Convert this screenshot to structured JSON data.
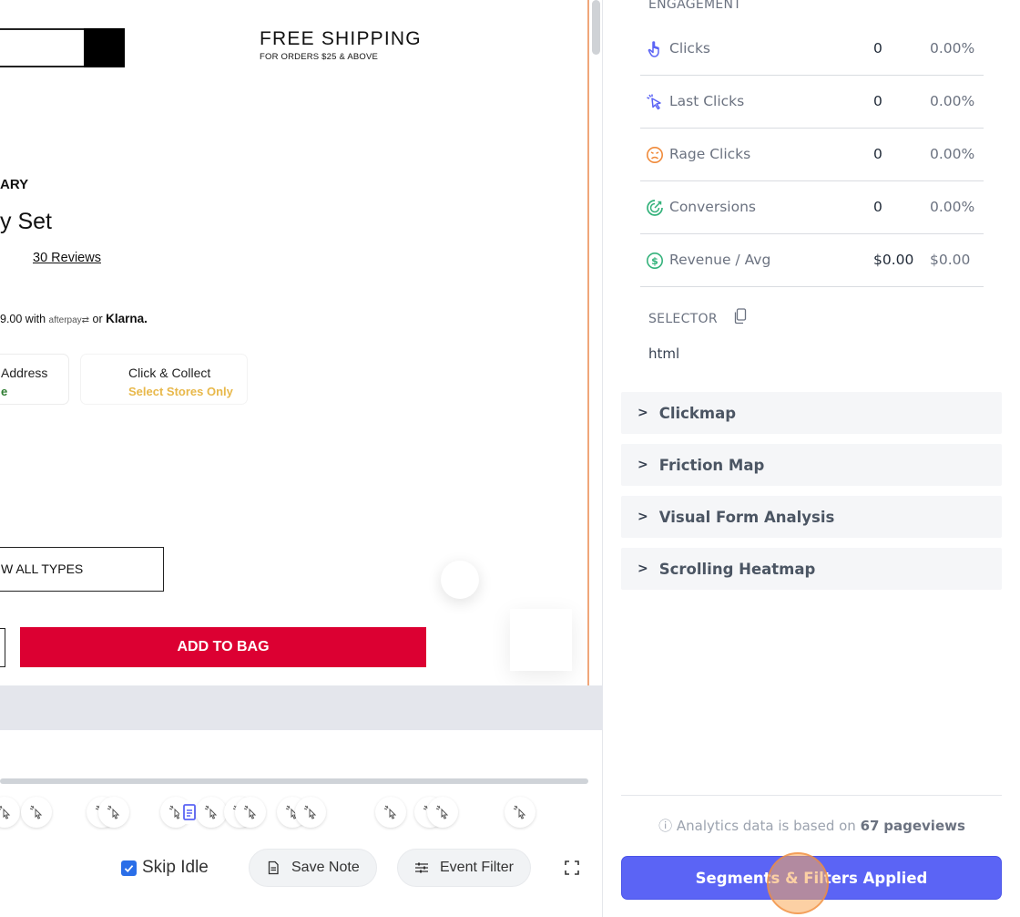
{
  "site": {
    "shipping_title": "FREE SHIPPING",
    "shipping_sub": "FOR ORDERS $25 & ABOVE",
    "brand": "ARY",
    "product_title": "y Set",
    "reviews": "30 Reviews",
    "afterpay_prefix": "9.00 with",
    "afterpay_brand": "afterpay",
    "afterpay_or": "or",
    "klarna": "Klarna.",
    "delivery_label": "Address",
    "delivery_status": "e",
    "collect_label": "Click & Collect",
    "collect_status": "Select Stores Only",
    "types_button": "W ALL TYPES",
    "add_to_bag": "ADD TO BAG"
  },
  "controls": {
    "skip_idle": "Skip Idle",
    "save_note": "Save Note",
    "event_filter": "Event Filter"
  },
  "panel": {
    "engagement_label": "ENGAGEMENT",
    "metrics": [
      {
        "name": "Clicks",
        "value": "0",
        "pct": "0.00%",
        "icon": "hand-pointer-icon"
      },
      {
        "name": "Last Clicks",
        "value": "0",
        "pct": "0.00%",
        "icon": "last-click-icon"
      },
      {
        "name": "Rage Clicks",
        "value": "0",
        "pct": "0.00%",
        "icon": "angry-face-icon"
      },
      {
        "name": "Conversions",
        "value": "0",
        "pct": "0.00%",
        "icon": "conversion-icon"
      },
      {
        "name": "Revenue / Avg",
        "value": "$0.00",
        "pct": "$0.00",
        "icon": "dollar-icon"
      }
    ],
    "selector_label": "SELECTOR",
    "selector_value": "html",
    "accordions": [
      "Clickmap",
      "Friction Map",
      "Visual Form Analysis",
      "Scrolling Heatmap"
    ],
    "info_prefix": "Analytics data is based on",
    "info_count": "67",
    "info_suffix": "pageviews",
    "segments_button": "Segments & Filters Applied"
  },
  "colors": {
    "accent": "#5b64f5",
    "add_to_bag": "#dc0032",
    "collect_status": "#e8b84a",
    "delivery_status": "#2f7d32",
    "cursor_highlight": "#f5a35c"
  }
}
